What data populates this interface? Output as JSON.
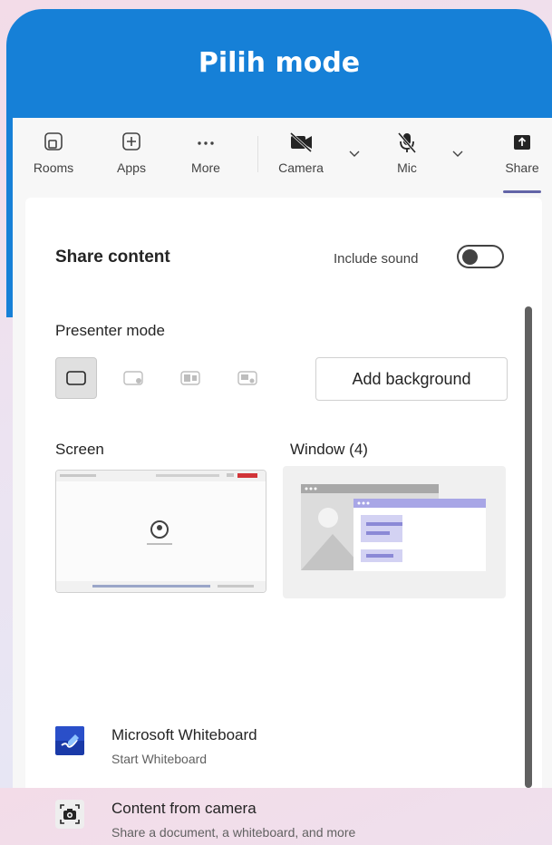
{
  "banner": {
    "title": "Pilih mode"
  },
  "toolbar": {
    "rooms": "Rooms",
    "apps": "Apps",
    "more": "More",
    "camera": "Camera",
    "mic": "Mic",
    "share": "Share"
  },
  "panel": {
    "title": "Share content",
    "include_sound": "Include sound",
    "include_sound_on": false,
    "presenter_mode": "Presenter mode",
    "add_background": "Add background",
    "screen_label": "Screen",
    "window_label": "Window (4)",
    "apps": [
      {
        "title": "Microsoft Whiteboard",
        "subtitle": "Start Whiteboard",
        "icon": "whiteboard-icon"
      },
      {
        "title": "Content from camera",
        "subtitle": "Share a document, a whiteboard, and more",
        "icon": "camera-content-icon"
      }
    ]
  },
  "colors": {
    "banner_blue": "#1680d7",
    "accent_purple": "#6264a7",
    "window_illustration_purple": "#a8a6e6",
    "whiteboard_blue": "#1a3aa8"
  }
}
